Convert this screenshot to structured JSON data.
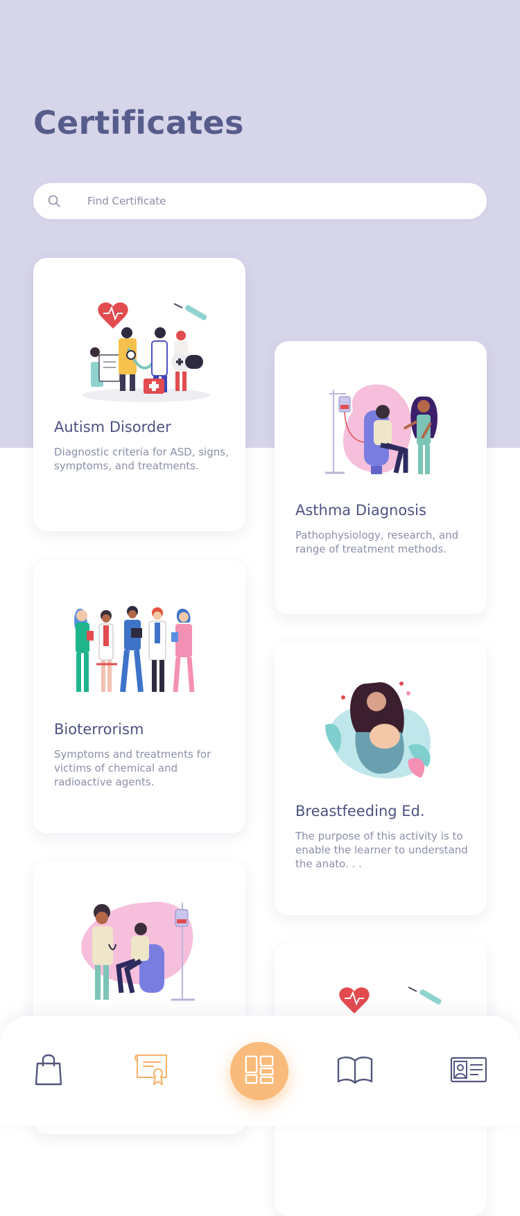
{
  "header": {
    "title": "Certificates"
  },
  "search": {
    "placeholder": "Find Certificate",
    "value": ""
  },
  "cards": [
    {
      "title": "Autism Disorder",
      "description": "Diagnostic criteria for ASD, signs, symptoms, and treatments."
    },
    {
      "title": "Asthma Diagnosis",
      "description": "Pathophysiology, research, and range of treatment methods."
    },
    {
      "title": "Bioterrorism",
      "description": "Symptoms and treatments for victims of chemical and radioactive agents."
    },
    {
      "title": "Breastfeeding Ed.",
      "description": "The purpose of this activity is to enable the learner to understand the anato. . ."
    },
    {
      "title": "",
      "description": ""
    },
    {
      "title": "",
      "description": ""
    }
  ],
  "tabbar": {
    "items": [
      {
        "icon": "shopping-bag-icon"
      },
      {
        "icon": "certificate-icon",
        "active": true
      },
      {
        "icon": "dashboard-grid-icon",
        "selected": true
      },
      {
        "icon": "open-book-icon"
      },
      {
        "icon": "id-card-icon"
      }
    ]
  },
  "colors": {
    "header_bg": "#d7d5ea",
    "title": "#565c8b",
    "accent": "#f9bb7b",
    "card_title": "#4d5280",
    "card_text": "#8b8fa8"
  }
}
